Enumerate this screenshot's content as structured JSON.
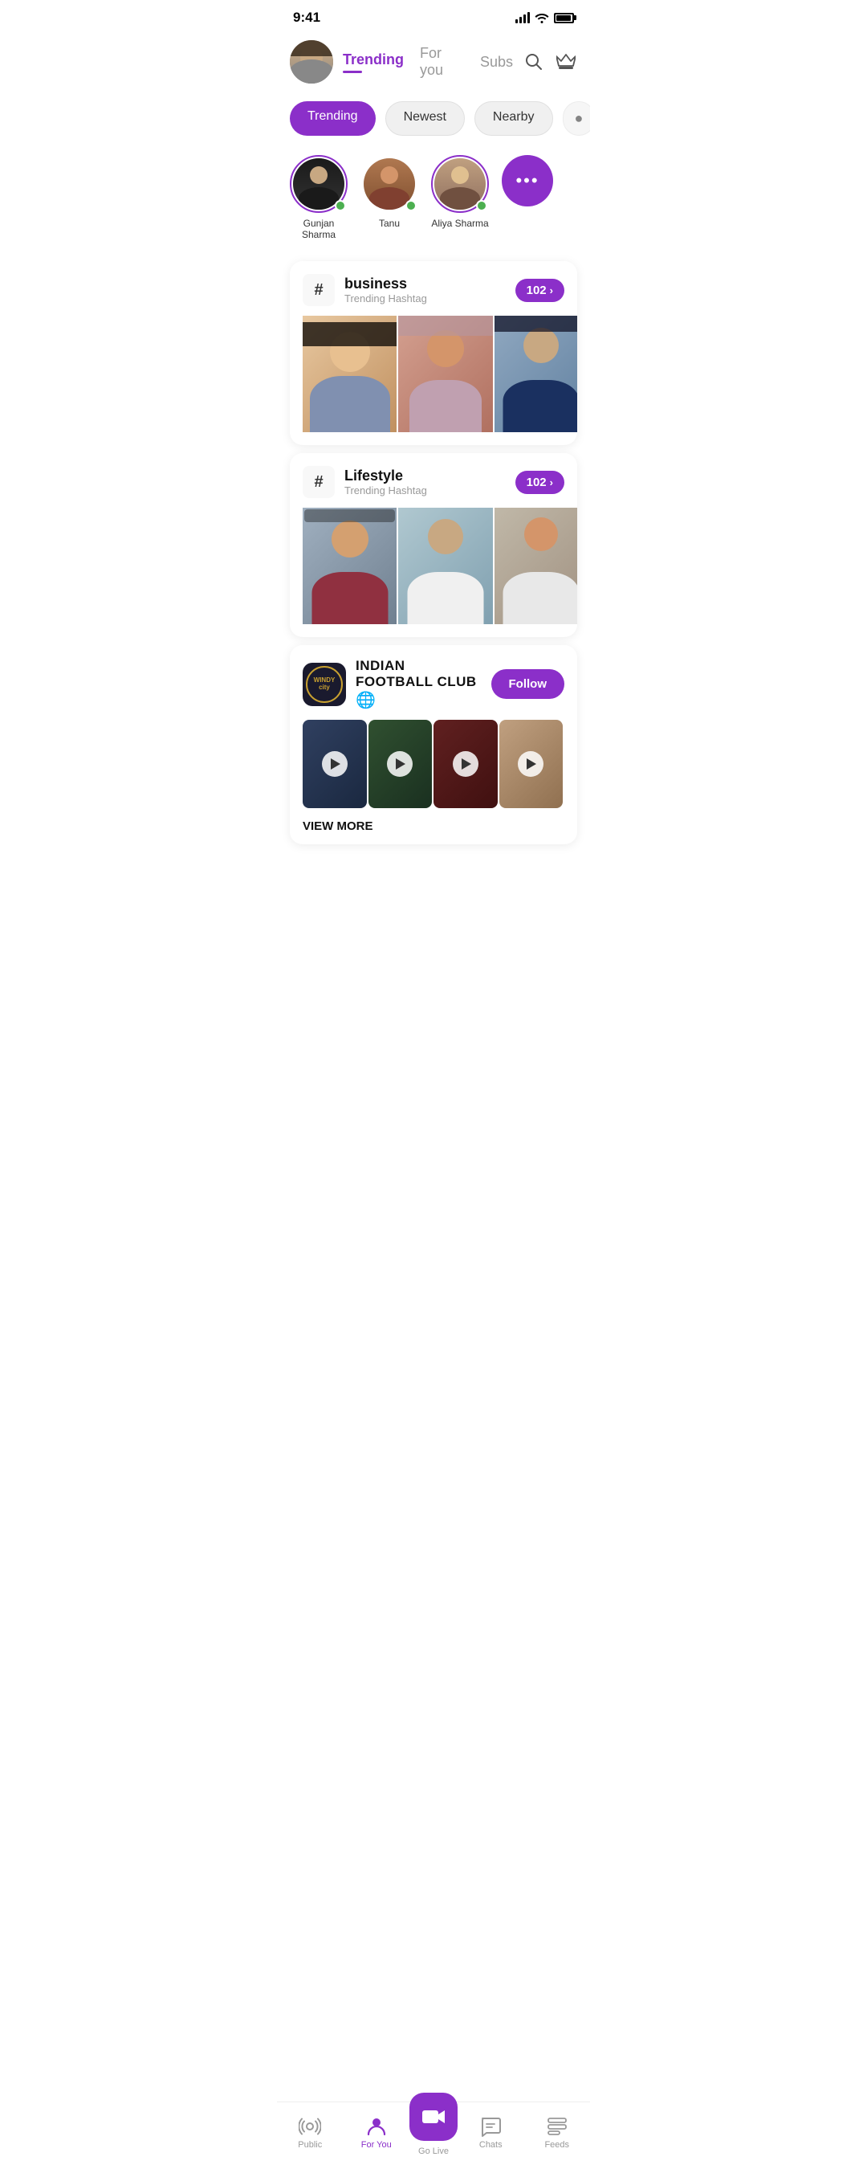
{
  "statusBar": {
    "time": "9:41",
    "batteryLevel": 85
  },
  "header": {
    "tabs": [
      {
        "id": "trending",
        "label": "Trending",
        "active": true
      },
      {
        "id": "for-you",
        "label": "For you",
        "active": false
      },
      {
        "id": "subs",
        "label": "Subs",
        "active": false
      }
    ]
  },
  "filters": [
    {
      "id": "trending",
      "label": "Trending",
      "active": true
    },
    {
      "id": "newest",
      "label": "Newest",
      "active": false
    },
    {
      "id": "nearby",
      "label": "Nearby",
      "active": false
    }
  ],
  "stories": [
    {
      "id": "gunjan",
      "name": "Gunjan Sharma",
      "online": true,
      "ring": true
    },
    {
      "id": "tanu",
      "name": "Tanu",
      "online": true,
      "ring": false
    },
    {
      "id": "aliya",
      "name": "Aliya Sharma",
      "online": true,
      "ring": true
    }
  ],
  "moreStoriesLabel": "...",
  "hashtags": [
    {
      "id": "business",
      "tag": "business",
      "subtitle": "Trending Hashtag",
      "count": "102",
      "images": [
        "img-p1",
        "img-p2",
        "img-p3"
      ]
    },
    {
      "id": "lifestyle",
      "tag": "Lifestyle",
      "subtitle": "Trending Hashtag",
      "count": "102",
      "images": [
        "img-l1",
        "img-l2",
        "img-l3"
      ]
    }
  ],
  "club": {
    "logoLine1": "WINDY",
    "logoLine2": "city",
    "name": "INDIAN FOOTBALL CLUB",
    "followLabel": "Follow",
    "viewMoreLabel": "VIEW MORE",
    "videos": [
      "vt1",
      "vt2",
      "vt3",
      "vt4"
    ]
  },
  "bottomNav": [
    {
      "id": "public",
      "label": "Public",
      "icon": "radio",
      "active": false
    },
    {
      "id": "for-you",
      "label": "For You",
      "icon": "person",
      "active": true
    },
    {
      "id": "go-live",
      "label": "Go Live",
      "icon": "camera",
      "active": false,
      "center": true
    },
    {
      "id": "chats",
      "label": "Chats",
      "icon": "chat",
      "active": false
    },
    {
      "id": "feeds",
      "label": "Feeds",
      "icon": "feeds",
      "active": false
    }
  ]
}
